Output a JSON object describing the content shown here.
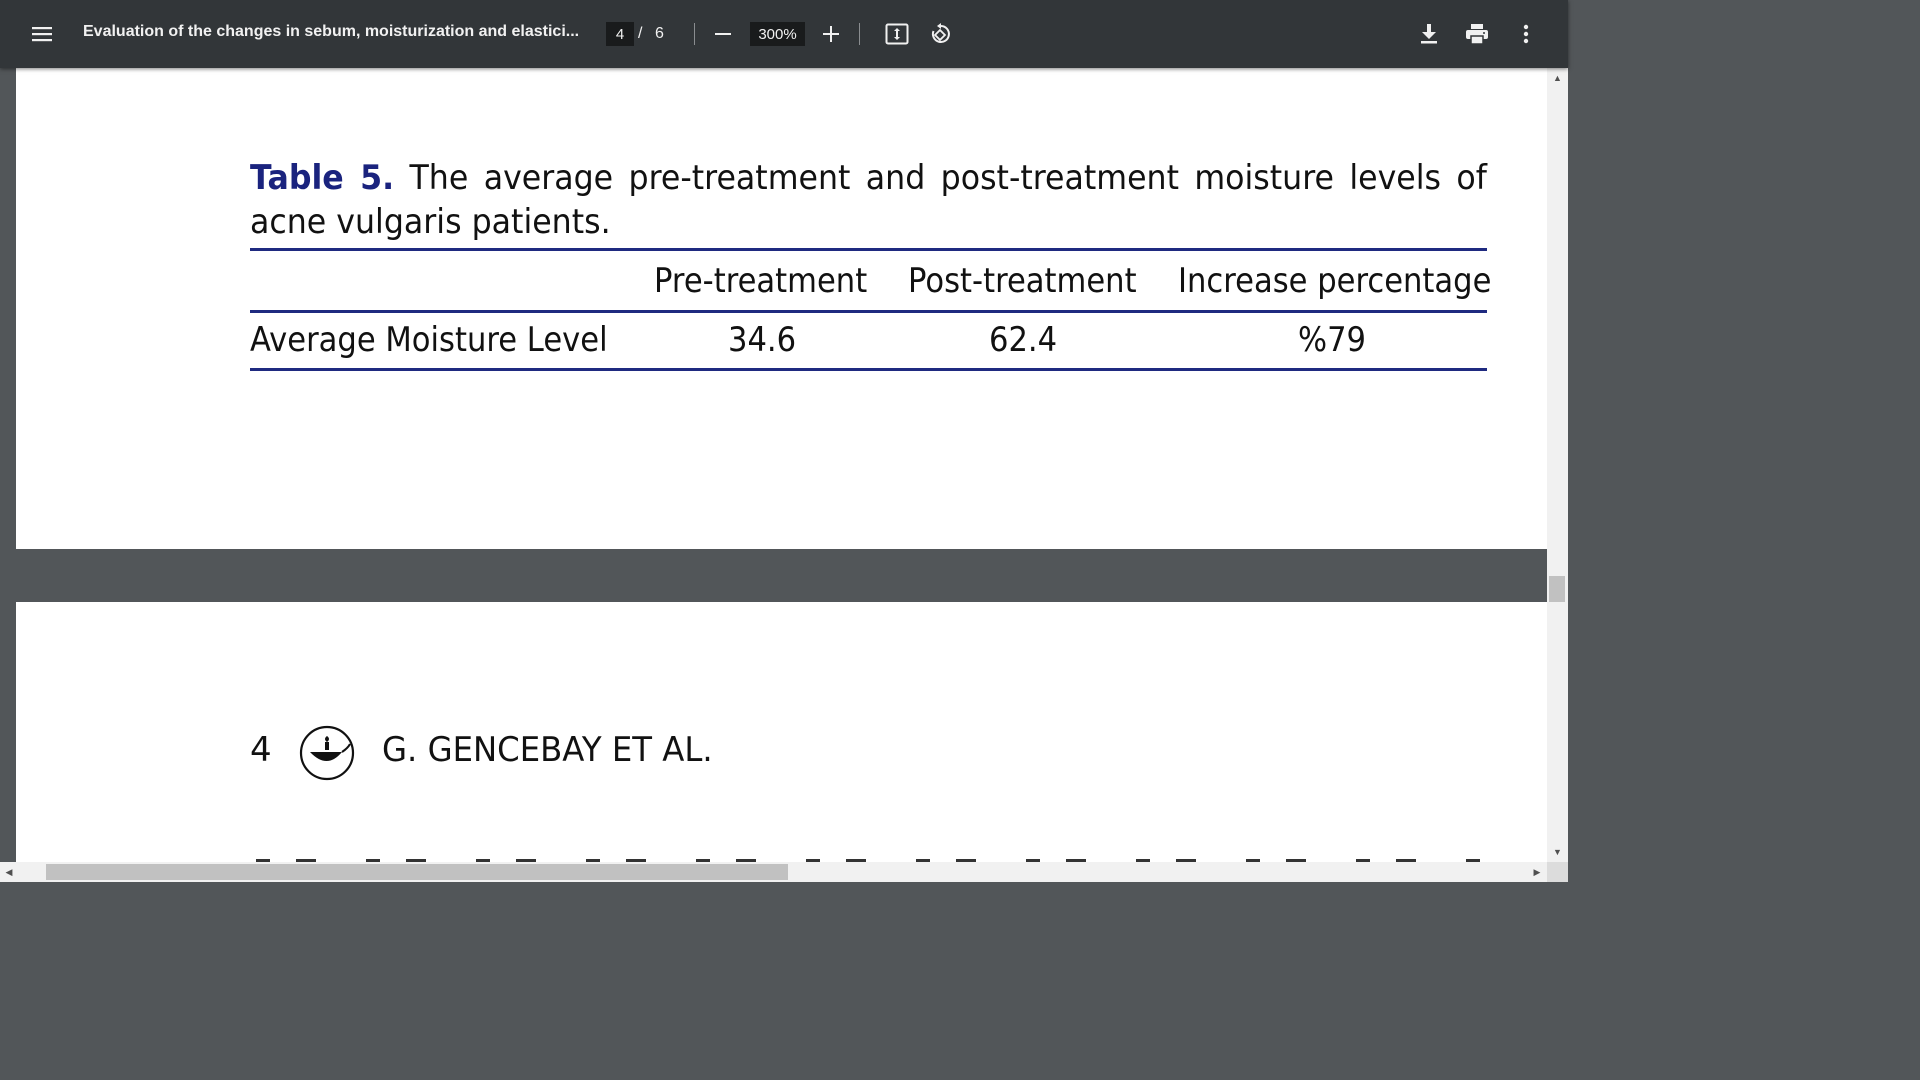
{
  "toolbar": {
    "title": "Evaluation of the changes in sebum, moisturization and elastici...",
    "page_current": "4",
    "page_separator": "/",
    "page_total": "6",
    "zoom": "300%",
    "icons": {
      "menu": "menu-icon",
      "zoom_out": "minus-icon",
      "zoom_in": "plus-icon",
      "fit": "fit-to-page-icon",
      "rotate": "rotate-icon",
      "download": "download-icon",
      "print": "print-icon",
      "more": "more-vertical-icon"
    }
  },
  "document": {
    "table": {
      "label": "Table 5.",
      "caption": "The average pre-treatment and post-treatment moisture levels of acne vulgaris patients.",
      "headers": [
        "Pre-treatment",
        "Post-treatment",
        "Increase percentage"
      ],
      "rows": [
        {
          "label": "Average Moisture Level",
          "values": [
            "34.6",
            "62.4",
            "%79"
          ]
        }
      ]
    },
    "next_page": {
      "page_number": "4",
      "running_head": "G. GENCEBAY ET AL."
    }
  },
  "colors": {
    "toolbar_bg": "#323639",
    "viewer_bg": "#525659",
    "table_rule": "#1f2a80",
    "table_label": "#1a237e"
  }
}
